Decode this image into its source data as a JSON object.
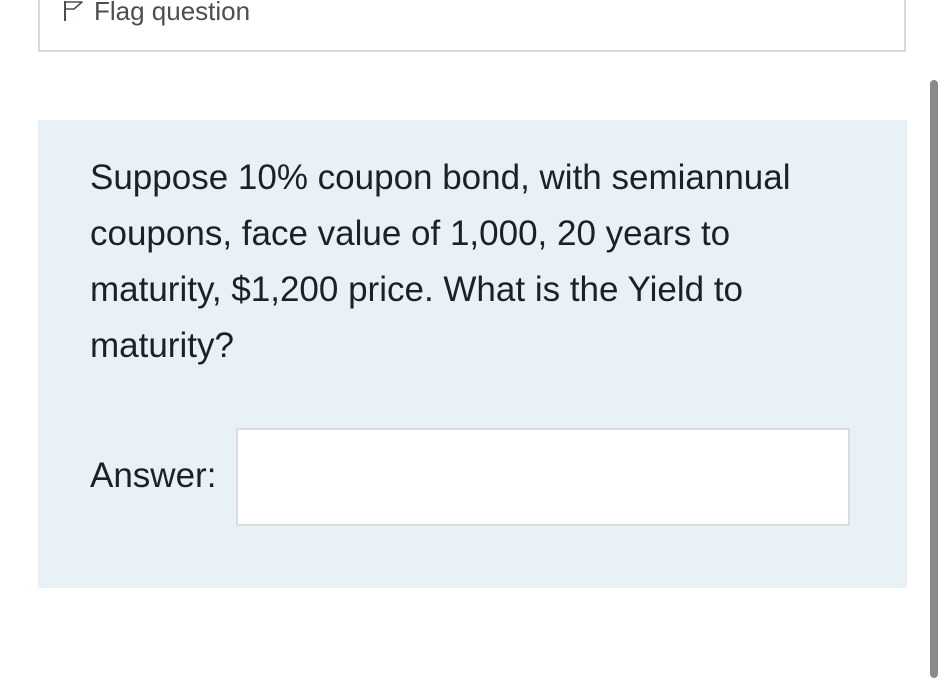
{
  "flag": {
    "label": "Flag question",
    "icon": "flag-icon"
  },
  "question": {
    "text": "Suppose 10% coupon bond, with semiannual coupons, face value of 1,000, 20 years to maturity, $1,200 price. What is the Yield to maturity?",
    "answer_label": "Answer:",
    "answer_value": ""
  },
  "colors": {
    "question_bg": "#e7f1f6",
    "text": "#1d2125",
    "border": "#d7dadd"
  }
}
